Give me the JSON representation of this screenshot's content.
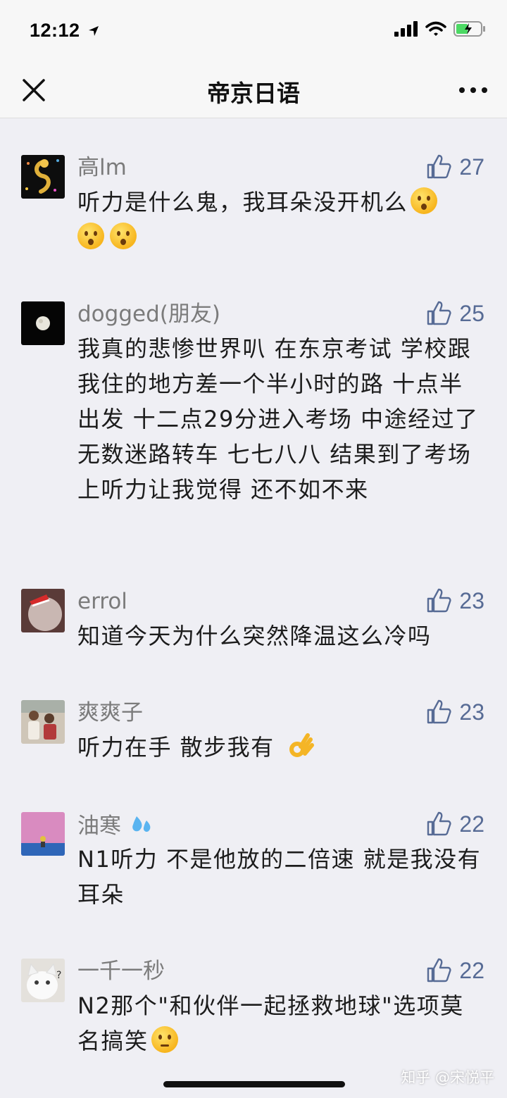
{
  "status_bar": {
    "time": "12:12"
  },
  "nav": {
    "title": "帝京日语"
  },
  "comments": [
    {
      "author": "高lm",
      "likes": "27",
      "text": "听力是什么鬼，我耳朵没开机么",
      "emoji_count": 3
    },
    {
      "author": "dogged(朋友)",
      "likes": "25",
      "text": "我真的悲惨世界叭 在东京考试 学校跟我住的地方差一个半小时的路 十点半出发 十二点29分进入考场 中途经过了无数迷路转车 七七八八 结果到了考场上听力让我觉得 还不如不来"
    },
    {
      "author": "errol",
      "likes": "23",
      "text": "知道今天为什么突然降温这么冷吗"
    },
    {
      "author": "爽爽子",
      "likes": "23",
      "text": "听力在手 散步我有"
    },
    {
      "author": "油寒",
      "likes": "22",
      "text": "N1听力 不是他放的二倍速 就是我没有耳朵"
    },
    {
      "author": "一千一秒",
      "likes": "22",
      "text": "N2那个\"和伙伴一起拯救地球\"选项莫名搞笑"
    }
  ],
  "icons": {
    "close": "close-icon",
    "more": "more-icon",
    "like": "thumbs-up-icon",
    "accent_color": "#576b95"
  },
  "watermark": "知乎 @宋悦平"
}
